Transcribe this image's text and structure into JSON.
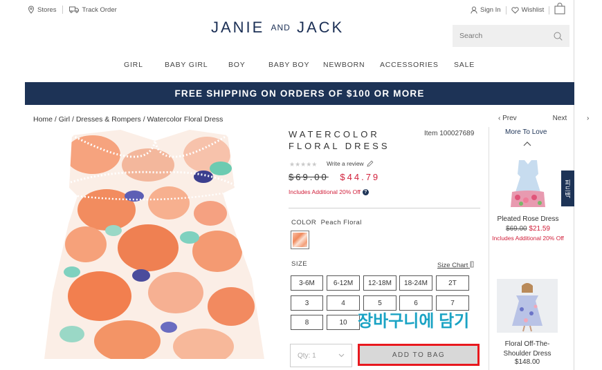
{
  "header": {
    "stores_label": "Stores",
    "track_order_label": "Track Order",
    "sign_in_label": "Sign In",
    "wishlist_label": "Wishlist",
    "logo_left": "JANIE",
    "logo_and": "AND",
    "logo_right": "JACK",
    "search_placeholder": "Search"
  },
  "nav": {
    "items": [
      "GIRL",
      "BABY GIRL",
      "BOY",
      "BABY BOY",
      "NEWBORN",
      "ACCESSORIES",
      "SALE"
    ]
  },
  "banner": {
    "text": "FREE SHIPPING ON ORDERS OF $100 OR MORE"
  },
  "breadcrumb": {
    "text": "Home / Girl / Dresses & Rompers / Watercolor Floral Dress"
  },
  "product": {
    "title_line1": "WATERCOLOR",
    "title_line2": "FLORAL DRESS",
    "item_number": "Item 100027689",
    "rating_stars": "★★★★★",
    "write_review": "Write a review",
    "price_original": "$69.00",
    "price_sale": "$44.79",
    "promo_text": "Includes Additional 20% Off",
    "color_label": "COLOR",
    "color_value": "Peach Floral",
    "size_label": "SIZE",
    "size_chart_label": "Size Chart",
    "sizes": [
      "3-6M",
      "6-12M",
      "12-18M",
      "18-24M",
      "2T",
      "3",
      "4",
      "5",
      "6",
      "7",
      "8",
      "10"
    ],
    "qty_label": "Qty: 1",
    "add_to_bag_label": "ADD TO BAG"
  },
  "annotation": {
    "overlay_text": "장바구니에 담기"
  },
  "side": {
    "prev_label": "Prev",
    "next_label": "Next",
    "more_to_love": "More To Love",
    "tab_label": "피드백",
    "rec1": {
      "name": "Pleated Rose Dress",
      "price_original": "$69.00",
      "price_sale": "$21.59",
      "promo": "Includes Additional 20% Off"
    },
    "rec2": {
      "name_line1": "Floral Off-The-",
      "name_line2": "Shoulder Dress",
      "price": "$148.00"
    }
  },
  "colors": {
    "navy": "#1d3356",
    "sale_red": "#d11f3a",
    "highlight_red": "#e8181e",
    "overlay_cyan": "#1aa3c4"
  }
}
